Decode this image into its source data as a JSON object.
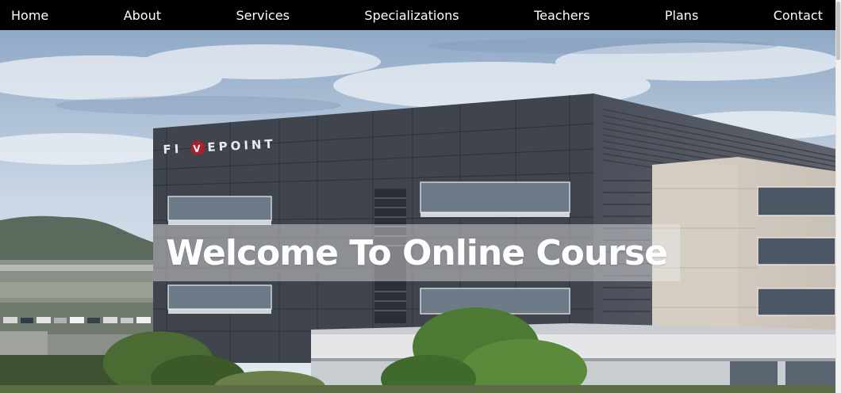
{
  "nav": {
    "items": [
      {
        "label": "Home"
      },
      {
        "label": "About"
      },
      {
        "label": "Services"
      },
      {
        "label": "Specializations"
      },
      {
        "label": "Teachers"
      },
      {
        "label": "Plans"
      },
      {
        "label": "Contact"
      }
    ]
  },
  "hero": {
    "title": "Welcome To Online Course",
    "building_sign": "FIVEPOINT"
  },
  "colors": {
    "navbar_bg": "#000000",
    "nav_text": "#ffffff",
    "hero_title": "#ffffff"
  }
}
